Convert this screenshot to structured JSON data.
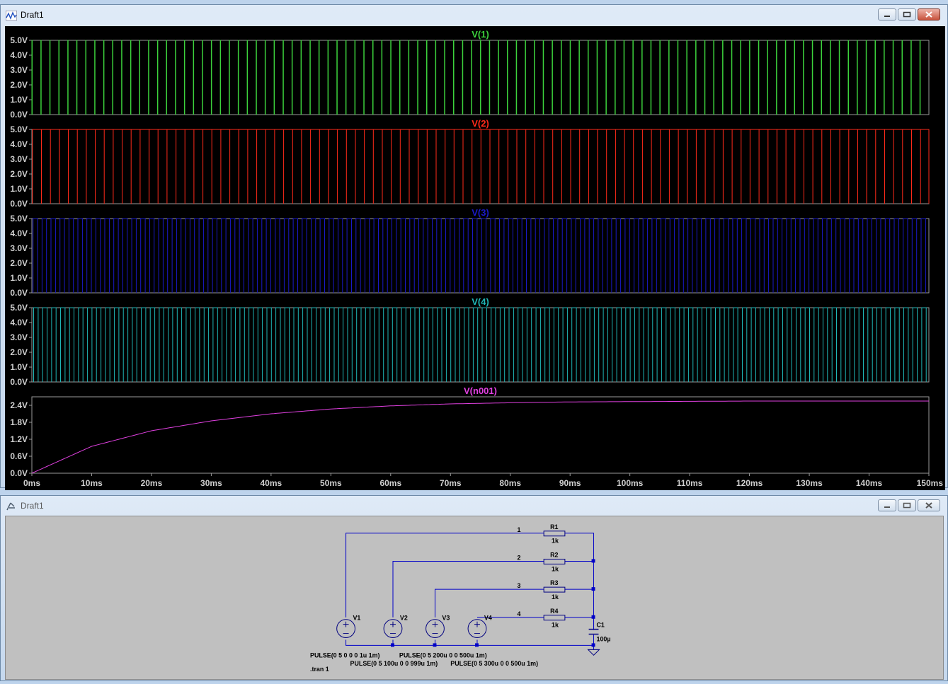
{
  "waveform_window": {
    "title": "Draft1",
    "icon": "waveform-app-icon",
    "controls": [
      "minimize-icon",
      "maximize-icon",
      "close-icon"
    ]
  },
  "schematic_window": {
    "title": "Draft1",
    "icon": "schematic-app-icon",
    "controls": [
      "minimize-icon",
      "maximize-icon",
      "close-icon"
    ]
  },
  "chart_data": {
    "type": "line",
    "xlabel": "",
    "x_ticks": [
      "0ms",
      "10ms",
      "20ms",
      "30ms",
      "40ms",
      "50ms",
      "60ms",
      "70ms",
      "80ms",
      "90ms",
      "100ms",
      "110ms",
      "120ms",
      "130ms",
      "140ms",
      "150ms"
    ],
    "x_range_ms": [
      0,
      150
    ],
    "grid": false,
    "panes": [
      {
        "name": "V(1)",
        "color": "#3cd23c",
        "y_ticks": [
          "5.0V",
          "4.0V",
          "3.0V",
          "2.0V",
          "1.0V",
          "0.0V"
        ],
        "ylim": [
          0,
          5
        ],
        "waveform": "PULSE(0 5 0 0 0 1u 1m)",
        "period_ms": 1,
        "width_ms": 0.001,
        "delay_ms": 0
      },
      {
        "name": "V(2)",
        "color": "#ff2a1a",
        "y_ticks": [
          "5.0V",
          "4.0V",
          "3.0V",
          "2.0V",
          "1.0V",
          "0.0V"
        ],
        "ylim": [
          0,
          5
        ],
        "waveform": "PULSE(0 5 100u 0 0 999u 1m)",
        "period_ms": 1,
        "width_ms": 0.999,
        "delay_ms": 0.1
      },
      {
        "name": "V(3)",
        "color": "#1a1ac8",
        "y_ticks": [
          "5.0V",
          "4.0V",
          "3.0V",
          "2.0V",
          "1.0V",
          "0.0V"
        ],
        "ylim": [
          0,
          5
        ],
        "waveform": "PULSE(0 5 200u 0 0 500u 1m)",
        "period_ms": 1,
        "width_ms": 0.5,
        "delay_ms": 0.2
      },
      {
        "name": "V(4)",
        "color": "#1fb6b6",
        "y_ticks": [
          "5.0V",
          "4.0V",
          "3.0V",
          "2.0V",
          "1.0V",
          "0.0V"
        ],
        "ylim": [
          0,
          5
        ],
        "waveform": "PULSE(0 5 300u 0 0 500u 1m)",
        "period_ms": 1,
        "width_ms": 0.5,
        "delay_ms": 0.3
      },
      {
        "name": "V(n001)",
        "color": "#e040e0",
        "y_ticks": [
          "2.4V",
          "1.8V",
          "1.2V",
          "0.6V",
          "0.0V"
        ],
        "ylim": [
          0,
          2.7
        ],
        "series": {
          "x": [
            0,
            10,
            20,
            30,
            40,
            50,
            60,
            70,
            80,
            90,
            100,
            110,
            120,
            130,
            140,
            150
          ],
          "y": [
            0,
            0.95,
            1.5,
            1.85,
            2.1,
            2.27,
            2.38,
            2.45,
            2.49,
            2.52,
            2.53,
            2.54,
            2.55,
            2.55,
            2.55,
            2.55
          ]
        }
      }
    ]
  },
  "schematic": {
    "nets": [
      "1",
      "2",
      "3",
      "4"
    ],
    "resistors": [
      {
        "ref": "R1",
        "value": "1k"
      },
      {
        "ref": "R2",
        "value": "1k"
      },
      {
        "ref": "R3",
        "value": "1k"
      },
      {
        "ref": "R4",
        "value": "1k"
      }
    ],
    "capacitor": {
      "ref": "C1",
      "value": "100µ"
    },
    "sources": [
      {
        "ref": "V1",
        "spec": "PULSE(0 5 0 0 0 1u 1m)"
      },
      {
        "ref": "V2",
        "spec": "PULSE(0 5 100u 0 0 999u 1m)"
      },
      {
        "ref": "V3",
        "spec": "PULSE(0 5 200u 0 0 500u 1m)"
      },
      {
        "ref": "V4",
        "spec": "PULSE(0 5 300u 0 0 500u 1m)"
      }
    ],
    "directive": ".tran 1",
    "colors": {
      "wire": "#0000c8",
      "component": "#000080",
      "text": "#000000"
    }
  }
}
